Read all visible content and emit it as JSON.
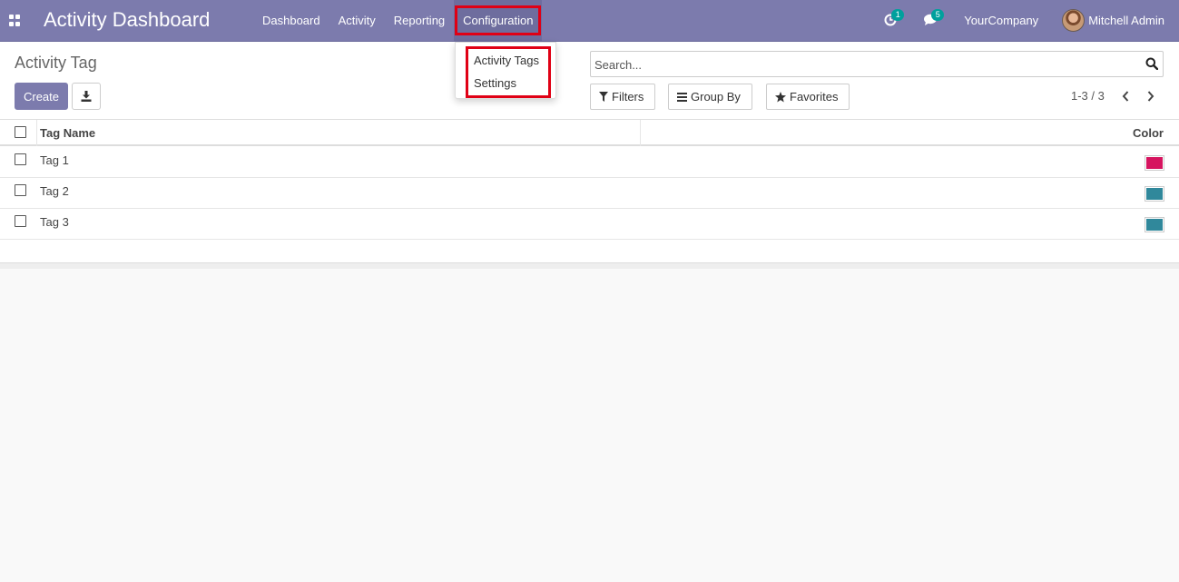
{
  "navbar": {
    "brand": "Activity Dashboard",
    "menu": [
      "Dashboard",
      "Activity",
      "Reporting",
      "Configuration"
    ],
    "activity_badge": "1",
    "message_badge": "5",
    "company": "YourCompany",
    "user": "Mitchell Admin",
    "color": "#7c7bad"
  },
  "dropdown": {
    "items": [
      "Activity Tags",
      "Settings"
    ]
  },
  "control_panel": {
    "breadcrumb": "Activity Tag",
    "create_label": "Create",
    "search_placeholder": "Search...",
    "filters_label": "Filters",
    "group_by_label": "Group By",
    "favorites_label": "Favorites",
    "pager": "1-3 / 3"
  },
  "table": {
    "headers": {
      "name": "Tag Name",
      "color": "Color"
    },
    "rows": [
      {
        "name": "Tag 1",
        "color": "#d6145f"
      },
      {
        "name": "Tag 2",
        "color": "#30889b"
      },
      {
        "name": "Tag 3",
        "color": "#30889b"
      }
    ]
  },
  "icons": {
    "apps": "apps-grid-icon",
    "activity": "clock-icon",
    "messages": "chat-icon",
    "export": "download-icon",
    "search": "search-icon",
    "filters": "filter-icon",
    "group_by": "bars-icon",
    "favorites": "star-icon",
    "prev": "chevron-left-icon",
    "next": "chevron-right-icon"
  }
}
